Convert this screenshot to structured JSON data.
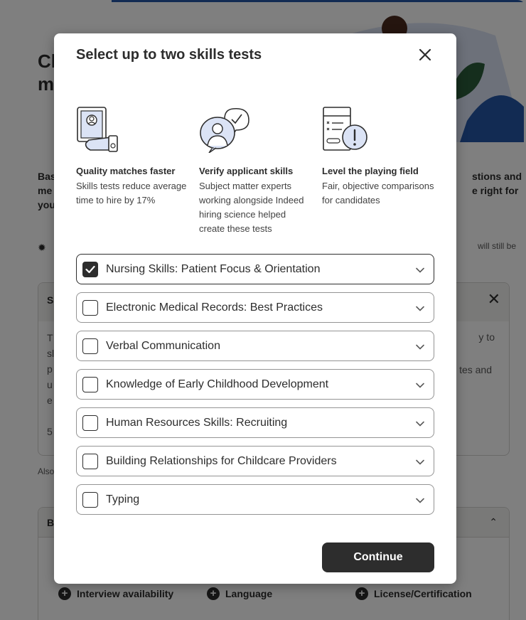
{
  "background": {
    "title_lines": [
      "Cl",
      "m"
    ],
    "desc_left_lines": [
      "Bas",
      "me",
      "you"
    ],
    "desc_right_lines": [
      "stions and",
      "e right for"
    ],
    "tip_right": "will still be",
    "card": {
      "header": "Sl",
      "body_lines": [
        "T",
        "sl",
        "p",
        "u",
        "e",
        "",
        "5"
      ],
      "right_line1": "y to",
      "right_line2": "tes and"
    },
    "also_text": "Also",
    "card2_header": "B",
    "chips": [
      "Interview availability",
      "Language",
      "License/Certification"
    ]
  },
  "modal": {
    "title": "Select up to two skills tests",
    "features": [
      {
        "icon": "id-badge-icon",
        "title": "Quality matches faster",
        "desc": "Skills tests reduce average time to hire by 17%"
      },
      {
        "icon": "verified-person-icon",
        "title": "Verify applicant skills",
        "desc": "Subject matter experts working alongside Indeed hiring science helped create these tests"
      },
      {
        "icon": "checklist-alert-icon",
        "title": "Level the playing field",
        "desc": "Fair, objective comparisons for candidates"
      }
    ],
    "options": [
      {
        "label": "Nursing Skills: Patient Focus & Orientation",
        "checked": true
      },
      {
        "label": "Electronic Medical Records: Best Practices",
        "checked": false
      },
      {
        "label": "Verbal Communication",
        "checked": false
      },
      {
        "label": "Knowledge of Early Childhood Development",
        "checked": false
      },
      {
        "label": "Human Resources Skills: Recruiting",
        "checked": false
      },
      {
        "label": "Building Relationships for Childcare Providers",
        "checked": false
      },
      {
        "label": "Typing",
        "checked": false
      }
    ],
    "continue_label": "Continue"
  }
}
